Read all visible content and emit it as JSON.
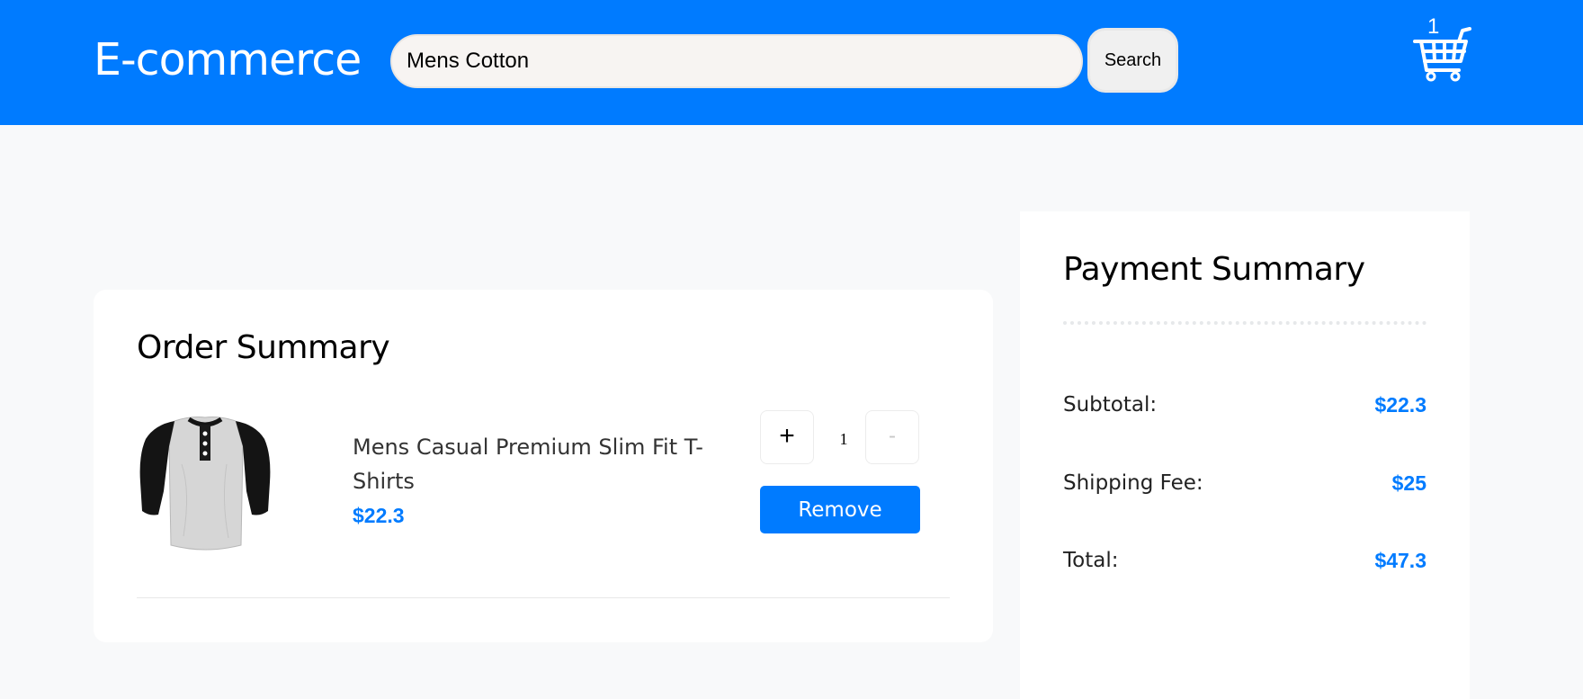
{
  "header": {
    "brand": "E-commerce",
    "search_value": "Mens Cotton",
    "search_button": "Search",
    "cart_count": "1",
    "cart_icon": "shopping-cart-icon"
  },
  "order_summary": {
    "title": "Order Summary",
    "items": [
      {
        "image_icon": "tshirt-image",
        "name": "Mens Casual Premium Slim Fit T-Shirts",
        "price": "$22.3",
        "quantity": "1",
        "plus_label": "+",
        "minus_label": "-",
        "remove_label": "Remove"
      }
    ]
  },
  "payment_summary": {
    "title": "Payment Summary",
    "rows": [
      {
        "label": "Subtotal:",
        "value": "$22.3"
      },
      {
        "label": "Shipping Fee:",
        "value": "$25"
      },
      {
        "label": "Total:",
        "value": "$47.3"
      }
    ]
  },
  "colors": {
    "primary": "#007bff",
    "page_background": "#f8f9fa",
    "card_background": "#ffffff"
  }
}
